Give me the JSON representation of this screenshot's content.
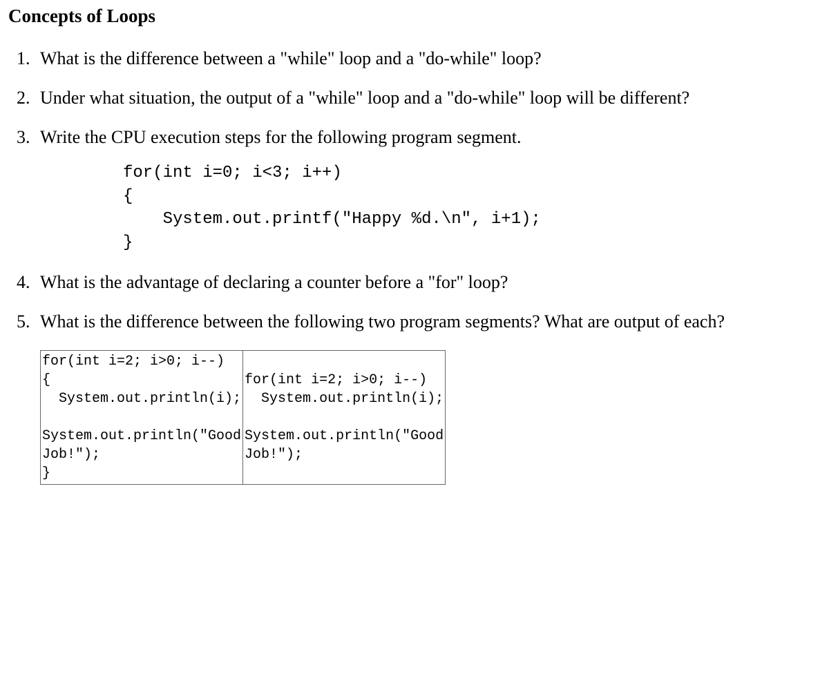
{
  "title": "Concepts of Loops",
  "questions": {
    "q1": "What is the difference between a \"while\" loop and a \"do-while\" loop?",
    "q2": "Under what situation, the output of a \"while\" loop and a \"do-while\" loop will be different?",
    "q3": "Write the CPU execution steps for the following program segment.",
    "q3_code": "for(int i=0; i<3; i++)\n{\n    System.out.printf(\"Happy %d.\\n\", i+1);\n}",
    "q4": "What is the advantage of declaring a counter before a \"for\" loop?",
    "q5": "What is the difference between the following two program segments? What are output of each?",
    "q5_code_left": "for(int i=2; i>0; i--)\n{\n  System.out.println(i);\n\nSystem.out.println(\"Good\nJob!\");\n}",
    "q5_code_right": "for(int i=2; i>0; i--)\n  System.out.println(i);\n\nSystem.out.println(\"Good\nJob!\");"
  }
}
